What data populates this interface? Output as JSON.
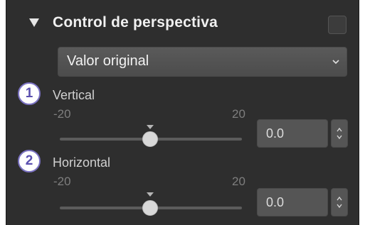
{
  "panel": {
    "title": "Control de perspectiva",
    "collapse_icon": "triangle-down-icon",
    "enabled": false
  },
  "dropdown": {
    "selected": "Valor original",
    "icon": "chevron-down-icon"
  },
  "callouts": [
    "1",
    "2"
  ],
  "sliders": [
    {
      "label": "Vertical",
      "min": "-20",
      "max": "20",
      "value": "0.0"
    },
    {
      "label": "Horizontal",
      "min": "-20",
      "max": "20",
      "value": "0.0"
    }
  ],
  "colors": {
    "panel_bg": "#2e2e2e",
    "callout_border": "#7b72c2",
    "callout_text": "#5b50b0"
  }
}
